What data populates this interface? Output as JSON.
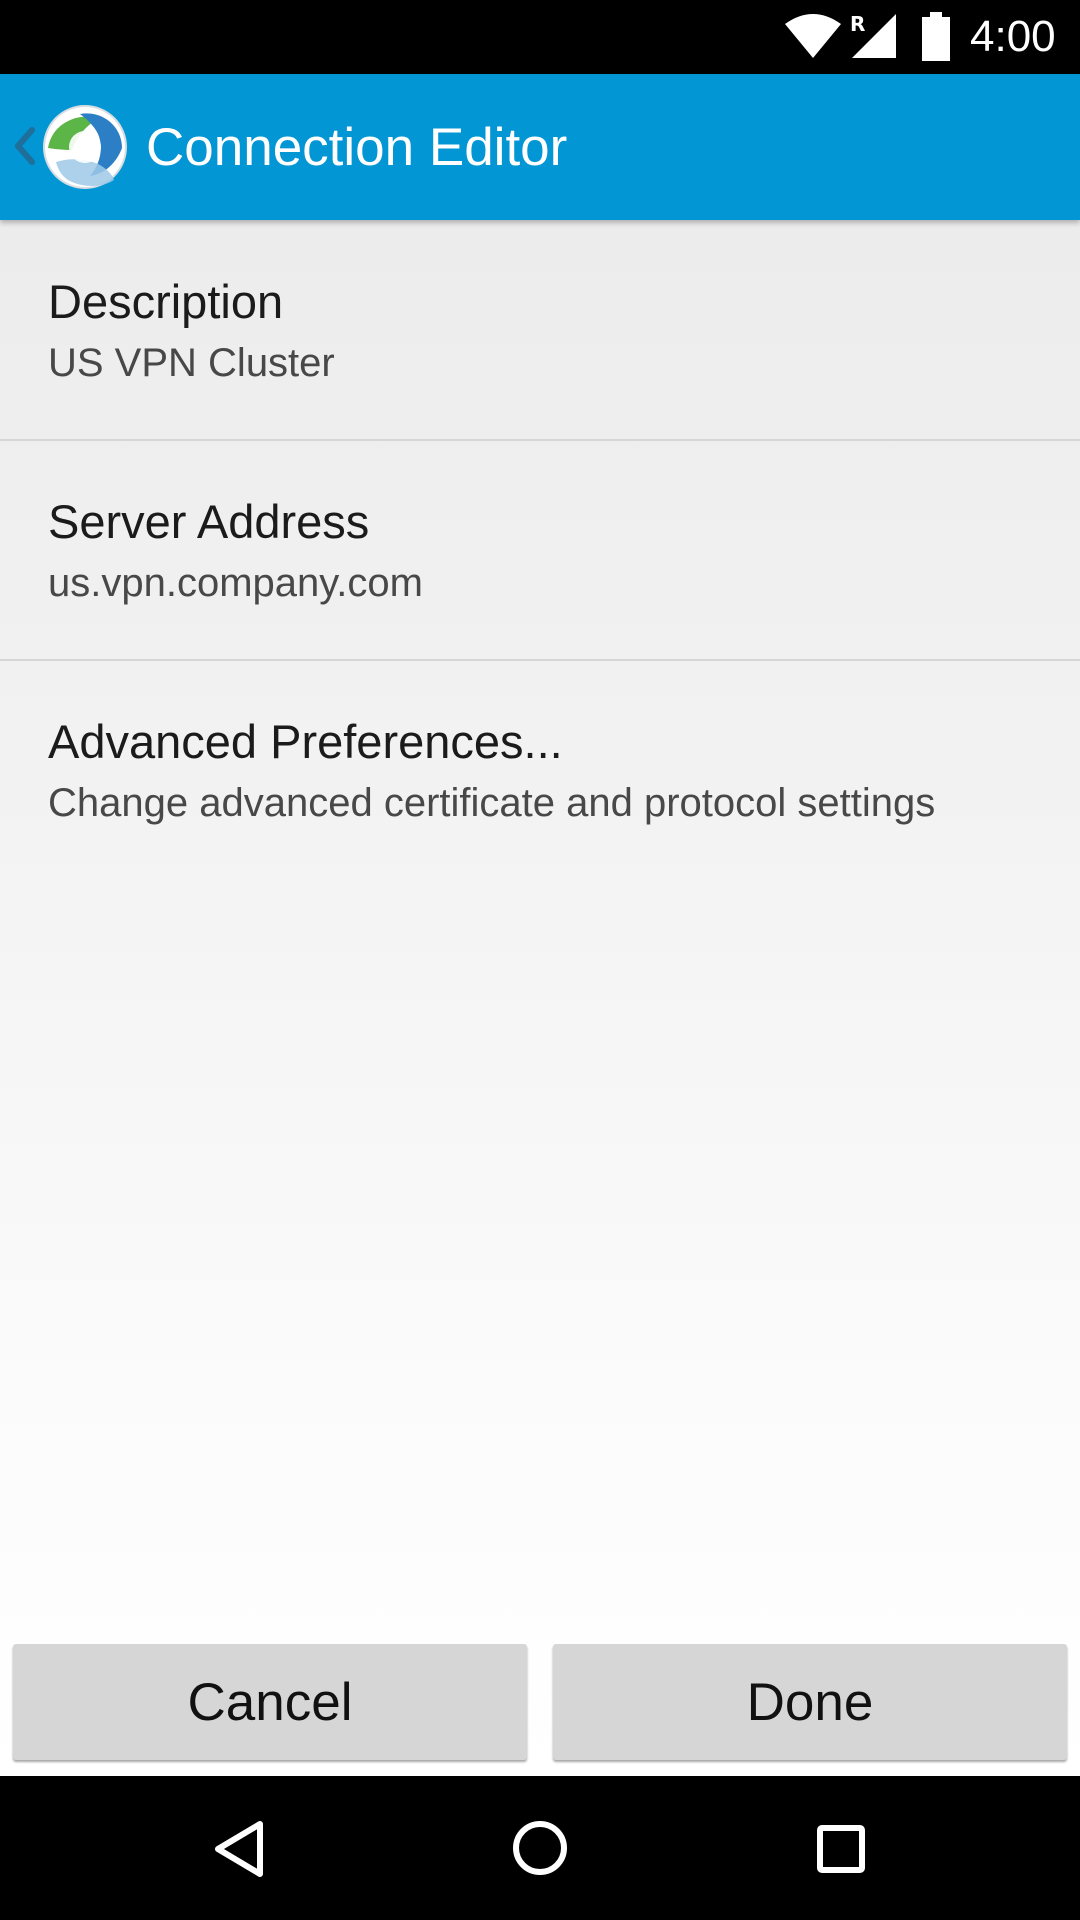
{
  "status_bar": {
    "time": "4:00",
    "roaming_indicator": "R",
    "icons": [
      "wifi-icon",
      "cell-signal-icon",
      "battery-icon"
    ]
  },
  "app_bar": {
    "title": "Connection Editor",
    "back_icon": "chevron-left-icon",
    "logo_icon": "anyconnect-logo-icon",
    "color": "#0296d4"
  },
  "preferences": [
    {
      "title": "Description",
      "summary": "US VPN Cluster"
    },
    {
      "title": "Server Address",
      "summary": "us.vpn.company.com"
    },
    {
      "title": "Advanced Preferences...",
      "summary": "Change advanced certificate and protocol settings"
    }
  ],
  "buttons": {
    "cancel_label": "Cancel",
    "done_label": "Done"
  },
  "nav_bar": {
    "icons": [
      "nav-back-icon",
      "nav-home-icon",
      "nav-recents-icon"
    ]
  }
}
